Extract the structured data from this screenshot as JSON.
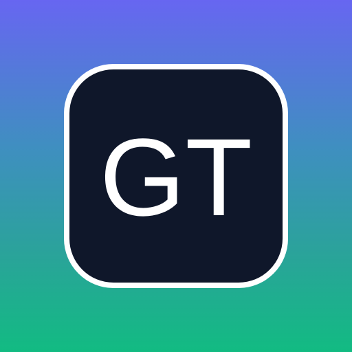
{
  "logo": {
    "monogram": "GT",
    "colors": {
      "background_top": "#6766f1",
      "background_bottom": "#12bb82",
      "tile_border": "#ffffff",
      "tile_fill": "#0f172a",
      "text": "#ffffff"
    }
  }
}
